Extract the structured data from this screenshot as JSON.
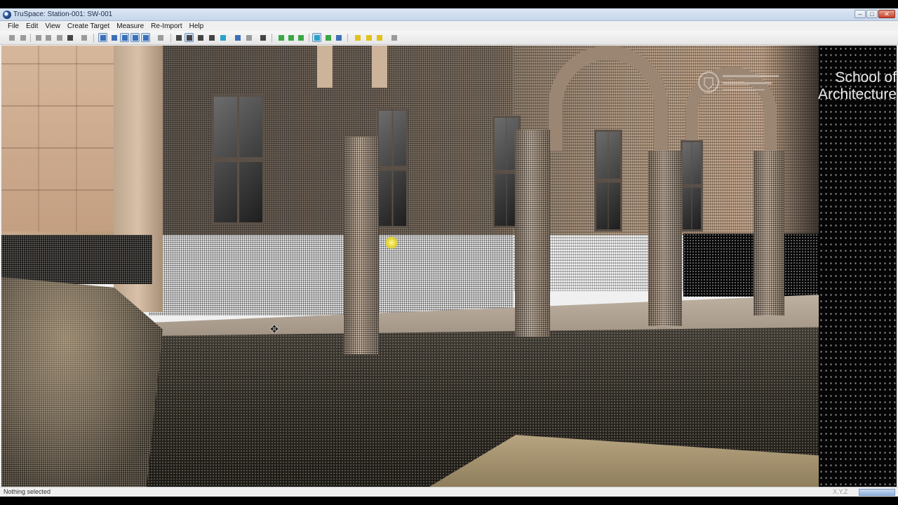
{
  "window": {
    "title": "TruSpace: Station-001: SW-001",
    "buttons": {
      "minimize": "–",
      "maximize": "□",
      "close": "✕"
    }
  },
  "menu": [
    "File",
    "Edit",
    "View",
    "Create Target",
    "Measure",
    "Re-Import",
    "Help"
  ],
  "toolbar": {
    "icons": [
      "undo-icon",
      "redo-icon",
      "cut-icon",
      "copy-icon",
      "paste-icon",
      "delete-icon",
      "find-icon",
      "zoom-extents-icon",
      "pan-icon",
      "zoom-window-icon",
      "zoom-icon",
      "view-icon",
      "select-icon",
      "select-box-icon",
      "select-point-icon",
      "move-icon",
      "rotate-icon",
      "measure-icon",
      "clip-icon",
      "grid-icon",
      "points-icon",
      "display-icon",
      "color-icon",
      "target-icon",
      "target-add-icon",
      "target-edit-icon",
      "settings-icon"
    ],
    "colors": {
      "active_border": "#6b8fb8",
      "active_fill": "#cfe0f5"
    }
  },
  "viewport": {
    "watermark_line1": "School of",
    "watermark_line2": "Architecture",
    "target_marker_color": "#e6d42a"
  },
  "status": {
    "text": "Nothing selected",
    "coords": "X,Y,Z"
  }
}
